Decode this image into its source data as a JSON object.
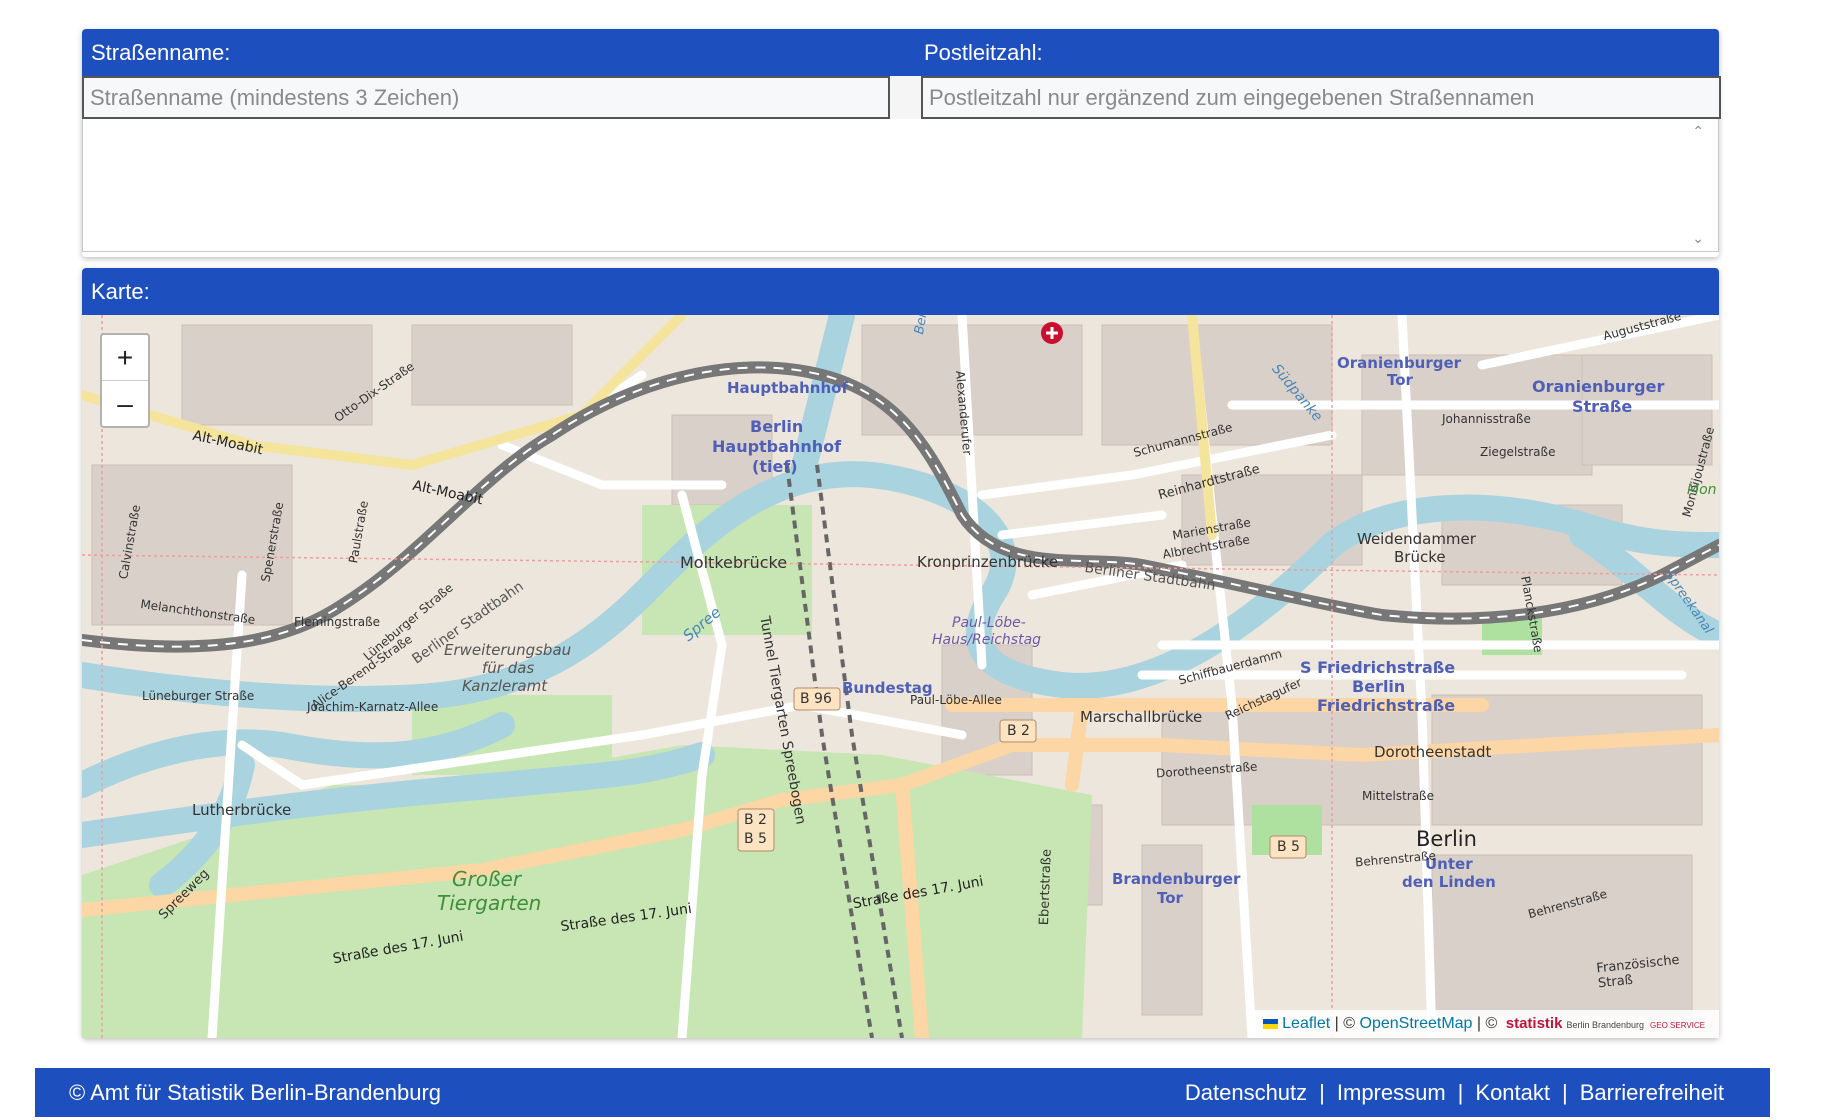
{
  "search": {
    "street_label": "Straßenname:",
    "postal_label": "Postleitzahl:",
    "street_placeholder": "Straßenname (mindestens 3 Zeichen)",
    "postal_placeholder": "Postleitzahl nur ergänzend zum eingegebenen Straßennamen",
    "street_value": "",
    "postal_value": ""
  },
  "map": {
    "title": "Karte:",
    "zoom_in": "+",
    "zoom_out": "–",
    "attribution": {
      "leaflet": "Leaflet",
      "separator1": "| ©",
      "osm": "OpenStreetMap",
      "separator2": "| ©",
      "statistik": "statistik",
      "statistik_sub": "Berlin Brandenburg",
      "geo": "GEO SERVICE"
    },
    "labels": {
      "hauptbahnhof": "Hauptbahnhof",
      "berlin_hbf": "Berlin",
      "berlin_hbf2": "Hauptbahnhof",
      "berlin_hbf3": "(tief)",
      "alt_moabit": "Alt-Moabit",
      "alt_moabit2": "Alt-Moabit",
      "otto_dix": "Otto-Dix-Straße",
      "moltkebruecke": "Moltkebrücke",
      "kronprinzenbruecke": "Kronprinzenbrücke",
      "paul_loebe": "Paul-Löbe-",
      "paul_loebe2": "Haus/Reichstag",
      "bundestag": "Bundestag",
      "paul_loebe_allee": "Paul-Löbe-Allee",
      "tunnel": "Tunnel Tiergarten Spreebogen",
      "erweiterungsbau": "Erweiterungsbau",
      "fuer_das": "für das",
      "kanzleramt": "Kanzleramt",
      "berliner_stadtbahn": "Berliner Stadtbahn",
      "berliner_stadtbahn2": "Berliner Stadtbahn",
      "lueneburger": "Lüneburger Straße",
      "lueneburger2": "Lüneburger Straße",
      "alice_berend": "Alice-Berend-Straße",
      "joachim": "Joachim-Karnatz-Allee",
      "flemingstrasse": "Flemingstraße",
      "melanchthon": "Melanchthonstraße",
      "calvin": "Calvinstraße",
      "spener": "Spenerstraße",
      "paulstrasse": "Paulstraße",
      "spree": "Spree",
      "lutherbruecke": "Lutherbrücke",
      "spreeweg": "Spreeweg",
      "grosser": "Großer",
      "tiergarten": "Tiergarten",
      "str17_1": "Straße des 17. Juni",
      "str17_2": "Straße des 17. Juni",
      "str17_3": "Straße des 17. Juni",
      "b96": "B 96",
      "b2": "B 2",
      "b2b5a": "B 2",
      "b2b5b": "B 5",
      "b5": "B 5",
      "marschallbruecke": "Marschallbrücke",
      "schiffbauerdamm": "Schiffbauerdamm",
      "reichstagufer": "Reichstagufer",
      "s_friedrich": "S Friedrichstraße",
      "berlin_fr": "Berlin",
      "friedrichstrasse": "Friedrichstraße",
      "dorotheenstadt": "Dorotheenstadt",
      "dorotheenstrasse": "Dorotheenstraße",
      "mittelstrasse": "Mittelstraße",
      "berlin": "Berlin",
      "unter": "Unter",
      "den_linden": "den Linden",
      "brandenburger": "Brandenburger",
      "tor": "Tor",
      "behrenstrasse": "Behrenstraße",
      "behrenstrasse2": "Behrenstraße",
      "franzoesische": "Französische Straß",
      "oranienburger_tor": "Oranienburger",
      "oranienburger_tor2": "Tor",
      "oranienburger_str": "Oranienburger",
      "oranienburger_str2": "Straße",
      "johannisstrasse": "Johannisstraße",
      "ziegelstrasse": "Ziegelstraße",
      "schumannstrasse": "Schumannstraße",
      "reinhardtstrasse": "Reinhardtstraße",
      "marienstrasse": "Marienstraße",
      "albrechtstrasse": "Albrechtstraße",
      "weidendammer": "Weidendammer",
      "bruecke": "Brücke",
      "planckstrasse": "Planckstraße",
      "monbijou": "Monbijoustraße",
      "spreekanal": "Spreekanal",
      "alexanderufer": "Alexanderufer",
      "auguststrasse": "Auguststraße",
      "suedpanke": "Südpanke",
      "berlin_spandauer": "Berlin-Spandauer Schifff",
      "ebertstrasse": "Ebertstraße",
      "mon": "Mon"
    }
  },
  "footer": {
    "copyright": "© Amt für Statistik Berlin-Brandenburg",
    "links": [
      "Datenschutz",
      "Impressum",
      "Kontakt",
      "Barrierefreiheit"
    ],
    "separator": "|"
  }
}
